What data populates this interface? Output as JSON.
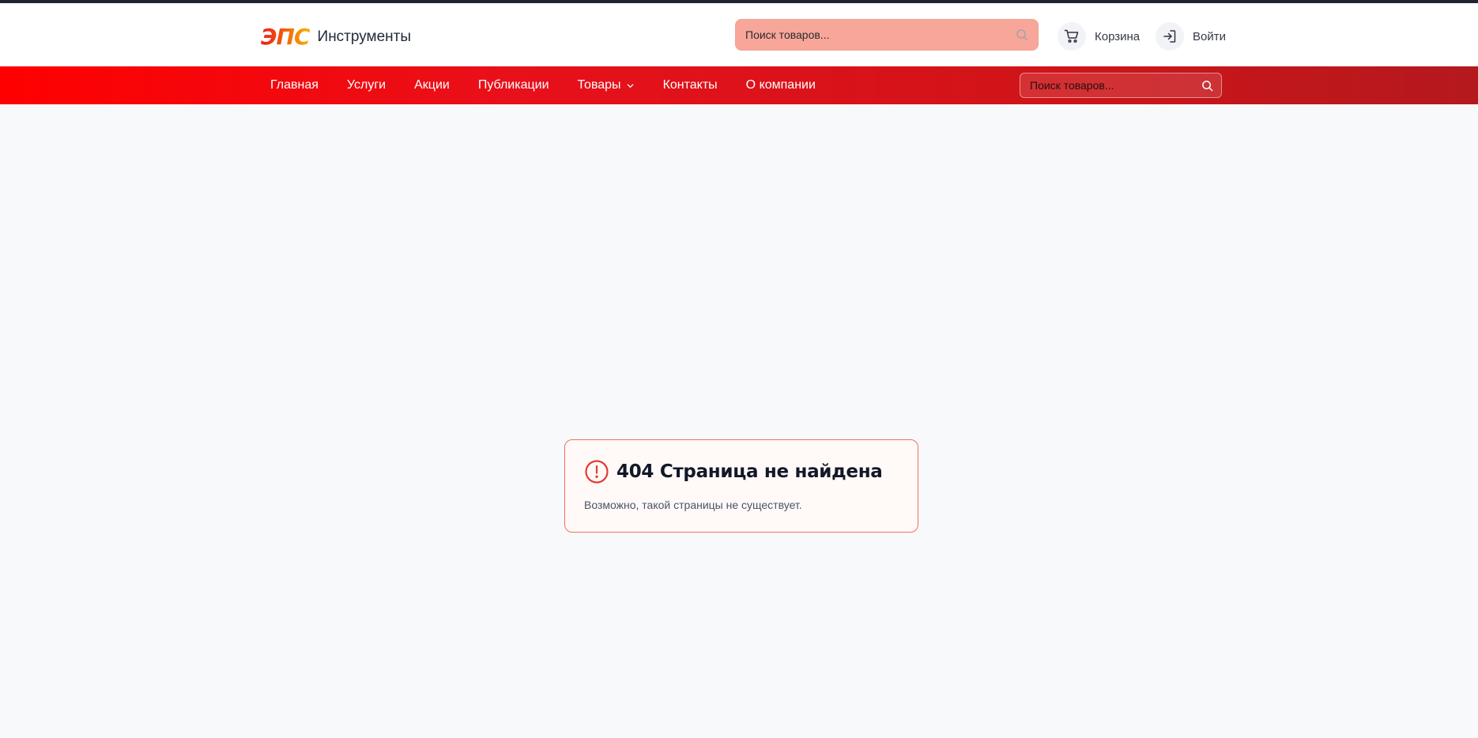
{
  "header": {
    "logo_mark": "ЭПС",
    "logo_text": "Инструменты",
    "search_placeholder": "Поиск товаров...",
    "cart_label": "Корзина",
    "login_label": "Войти"
  },
  "nav": {
    "items": [
      {
        "label": "Главная"
      },
      {
        "label": "Услуги"
      },
      {
        "label": "Акции"
      },
      {
        "label": "Публикации"
      },
      {
        "label": "Товары"
      },
      {
        "label": "Контакты"
      },
      {
        "label": "О компании"
      }
    ],
    "search_placeholder": "Поиск товаров..."
  },
  "error": {
    "title": "404 Страница не найдена",
    "message": "Возможно, такой страницы не существует."
  },
  "colors": {
    "accent_red": "#ff0000",
    "nav_gradient_end": "#b4191e",
    "search_top_bg": "#f8a69a",
    "error_border": "#ef7060",
    "error_icon": "#e53935",
    "background": "#f8f9fb"
  }
}
